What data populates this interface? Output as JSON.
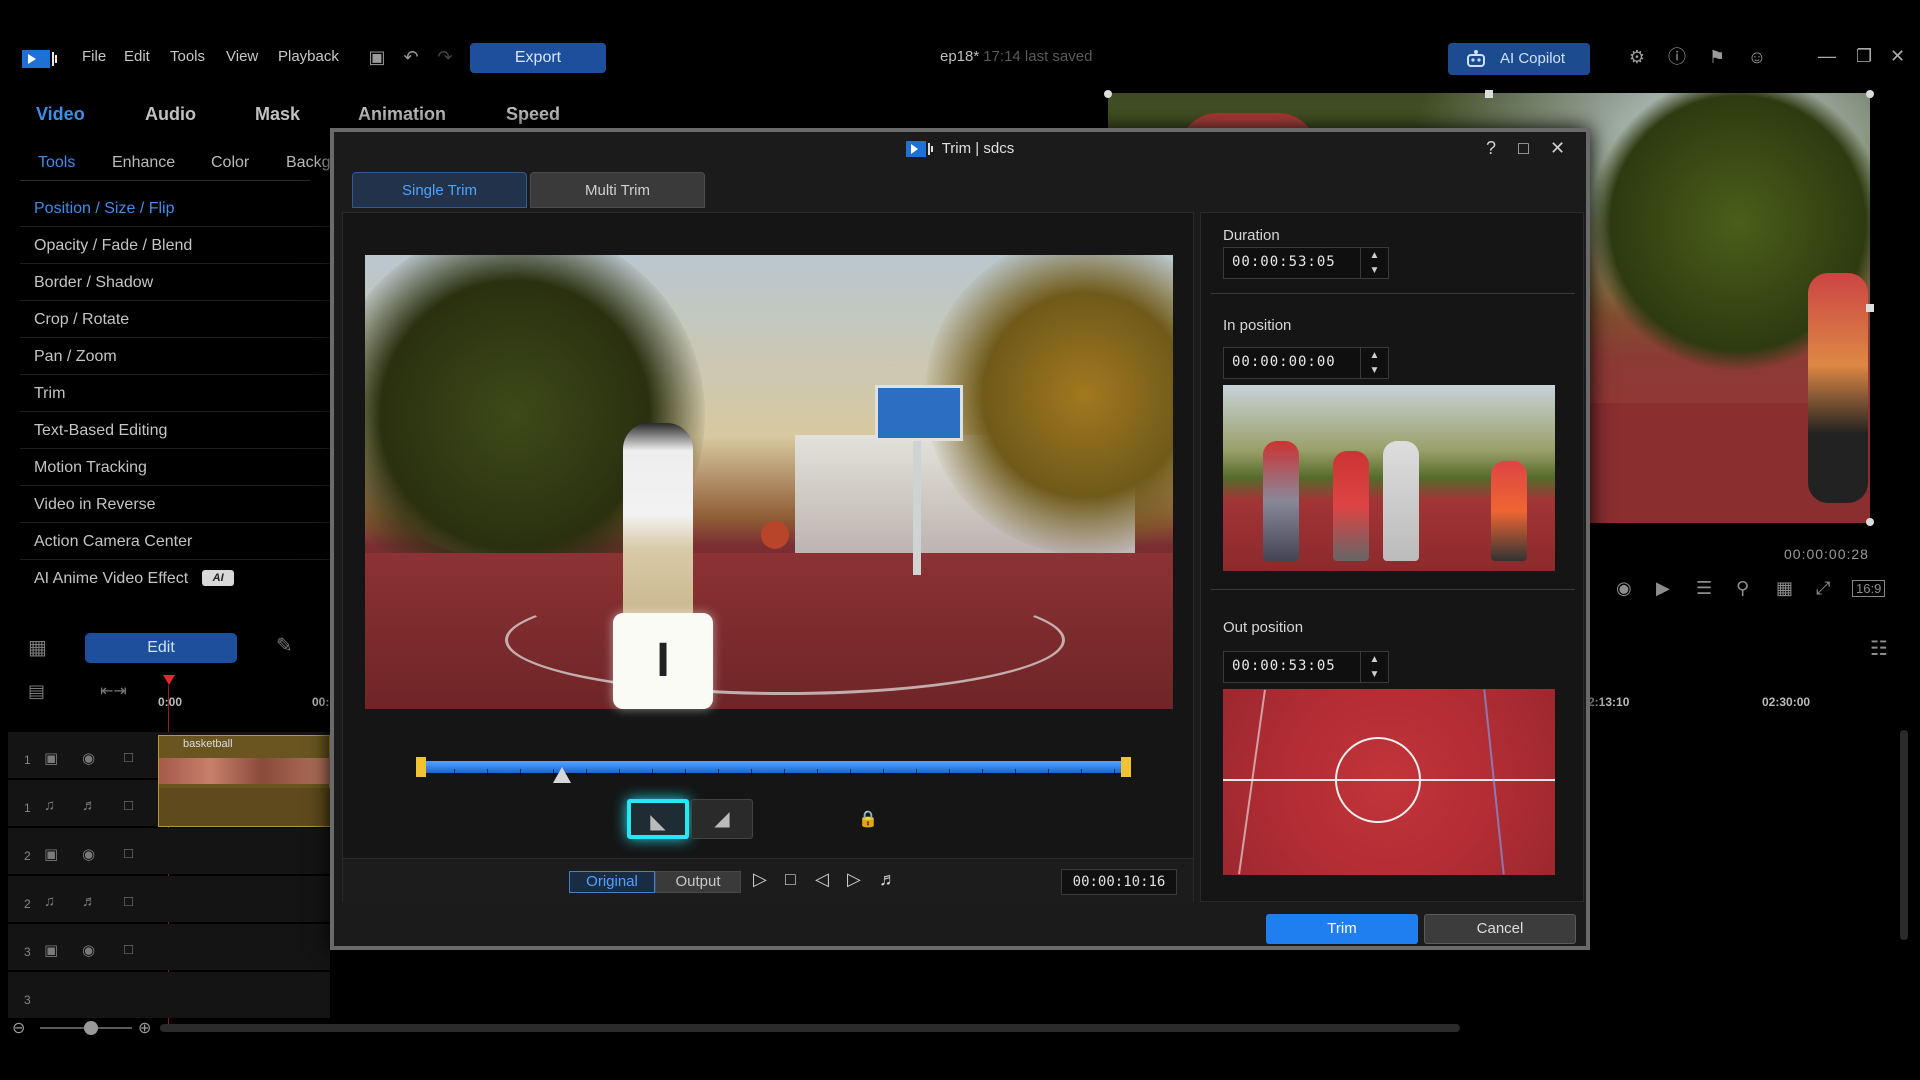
{
  "menubar": {
    "items": [
      "File",
      "Edit",
      "Tools",
      "View",
      "Playback"
    ],
    "export_label": "Export",
    "project_name": "ep18*",
    "saved_text": "17:14 last saved",
    "copilot_label": "AI Copilot"
  },
  "left_panel": {
    "main_tabs": [
      "Video",
      "Audio",
      "Mask",
      "Animation",
      "Speed"
    ],
    "sub_tabs": [
      "Tools",
      "Enhance",
      "Color",
      "Backg"
    ],
    "tools": [
      "Position / Size / Flip",
      "Opacity / Fade / Blend",
      "Border / Shadow",
      "Crop / Rotate",
      "Pan / Zoom",
      "Trim",
      "Text-Based Editing",
      "Motion Tracking",
      "Video in Reverse",
      "Action Camera Center",
      "AI Anime Video Effect"
    ],
    "ai_badge": "AI"
  },
  "timeline": {
    "edit_label": "Edit",
    "ruler_start": "0:00",
    "ruler_partial": "00:",
    "ruler_right": [
      "2:13:10",
      "02:30:00"
    ],
    "clip_name": "basketball",
    "track_numbers": [
      "1",
      "1",
      "2",
      "2",
      "3",
      "3"
    ]
  },
  "preview": {
    "timecode": "00:00:00:28",
    "aspect": "16:9"
  },
  "dialog": {
    "title": "Trim | sdcs",
    "tabs": [
      "Single Trim",
      "Multi Trim"
    ],
    "key_glyph": "I",
    "view_original": "Original",
    "view_output": "Output",
    "current_timecode": "00:00:10:16",
    "trim_in_fraction": 0.0,
    "trim_out_fraction": 1.0,
    "playhead_fraction": 0.2,
    "duration_label": "Duration",
    "duration_value": "00:00:53:05",
    "in_label": "In position",
    "in_value": "00:00:00:00",
    "out_label": "Out position",
    "out_value": "00:00:53:05",
    "trim_label": "Trim",
    "cancel_label": "Cancel"
  }
}
